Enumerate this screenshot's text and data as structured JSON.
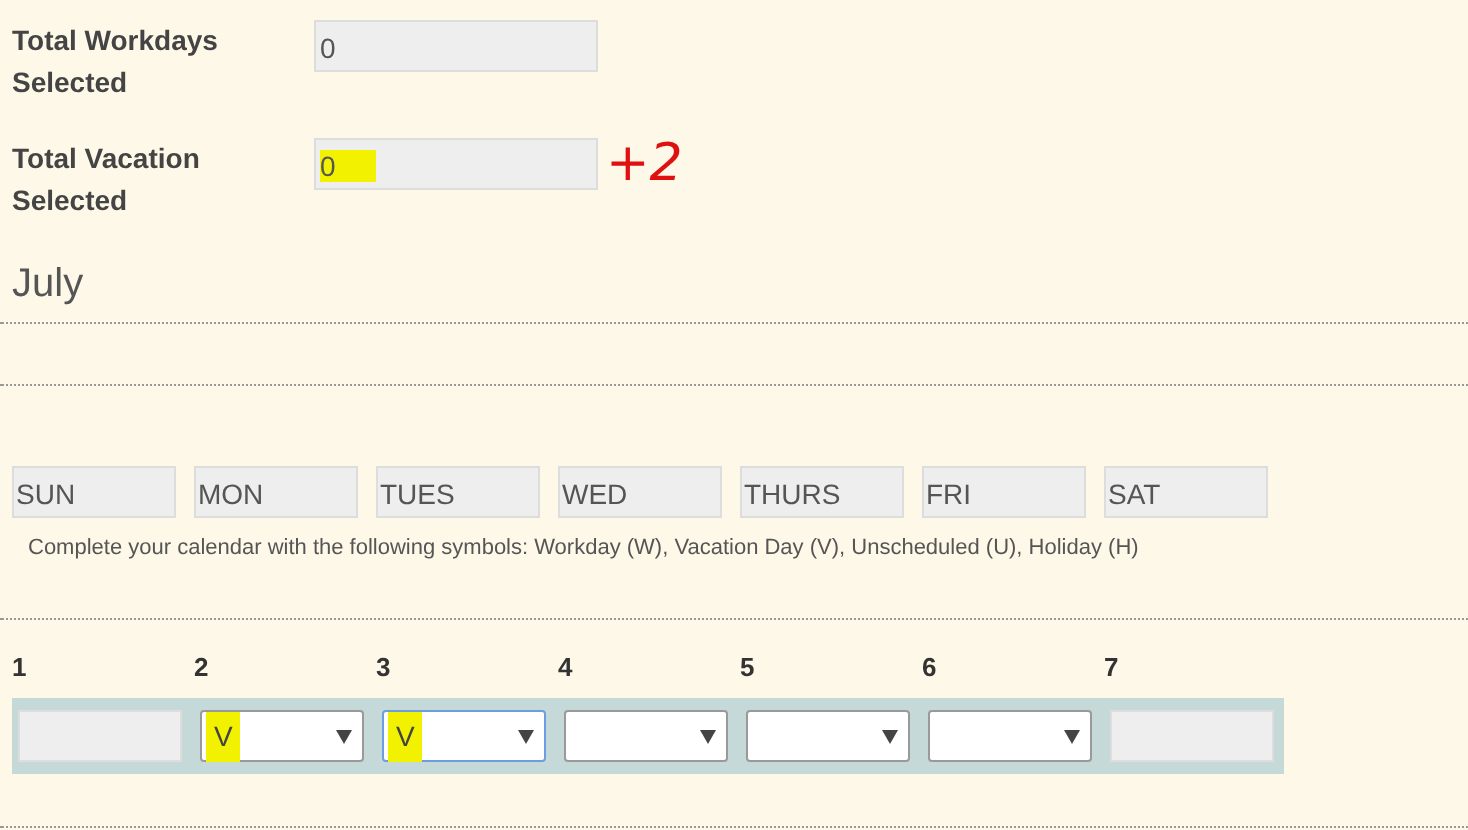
{
  "totals": [
    {
      "label": "Total Workdays Selected",
      "value": "0",
      "highlighted": false
    },
    {
      "label": "Total Vacation Selected",
      "value": "0",
      "highlighted": true,
      "annotation": "+2"
    }
  ],
  "month": "July",
  "weekdays": [
    "SUN",
    "MON",
    "TUES",
    "WED",
    "THURS",
    "FRI",
    "SAT"
  ],
  "instructions": "Complete your calendar with the following symbols: Workday (W), Vacation Day (V), Unscheduled (U), Holiday (H)",
  "days": [
    {
      "number": "1",
      "kind": "blank"
    },
    {
      "number": "2",
      "kind": "select",
      "value": "V",
      "highlighted": true,
      "focused": false
    },
    {
      "number": "3",
      "kind": "select",
      "value": "V",
      "highlighted": true,
      "focused": true
    },
    {
      "number": "4",
      "kind": "select",
      "focused": false
    },
    {
      "number": "5",
      "kind": "select",
      "focused": false
    },
    {
      "number": "6",
      "kind": "select",
      "focused": false
    },
    {
      "number": "7",
      "kind": "blank"
    }
  ]
}
